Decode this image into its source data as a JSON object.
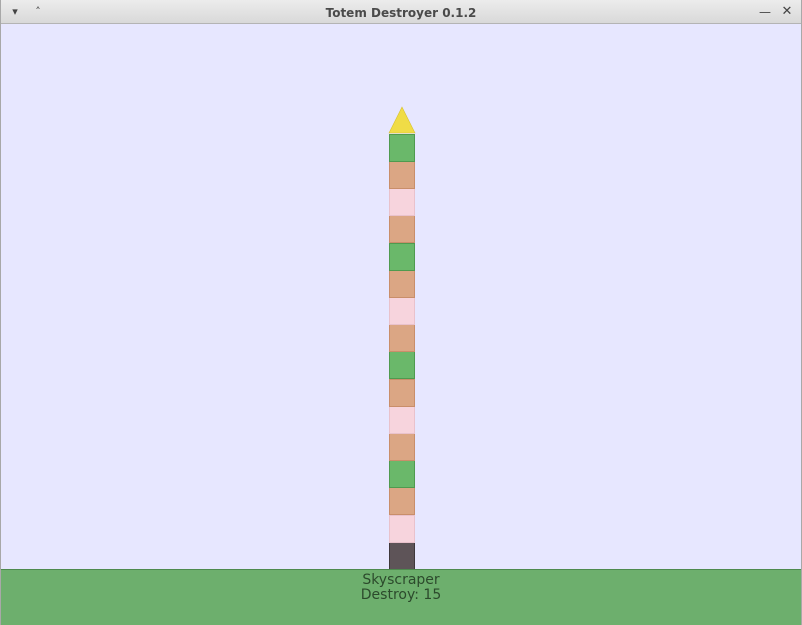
{
  "window": {
    "title": "Totem Destroyer 0.1.2"
  },
  "icons": {
    "menu": "chevron-down-icon",
    "shade": "chevron-up-icon",
    "minimize": "minimize-icon",
    "close": "close-icon"
  },
  "colors": {
    "sky": "#e7e7ff",
    "ground": "#6daf6d",
    "idol": "#f0dc46",
    "green_block": "#6ab86a",
    "orange_block": "#dba684",
    "pink_block": "#f7d4dd",
    "base_block": "#5e5458"
  },
  "totem": {
    "idol": "yellow-triangle",
    "blocks_top_to_bottom": [
      "green",
      "orange",
      "pink",
      "orange",
      "green",
      "orange",
      "pink",
      "orange",
      "green",
      "orange",
      "pink",
      "orange",
      "green",
      "orange",
      "pink",
      "base"
    ]
  },
  "hud": {
    "level_name": "Skyscraper",
    "destroy_label": "Destroy:",
    "destroy_count": "15"
  }
}
